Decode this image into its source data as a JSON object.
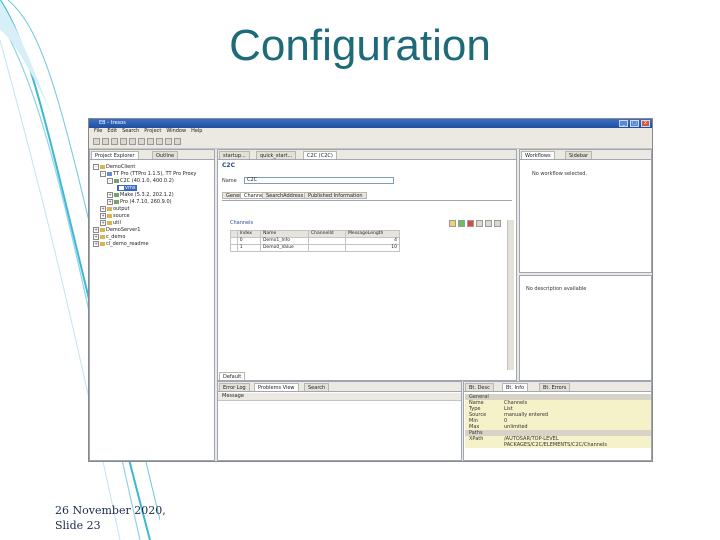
{
  "slide": {
    "title": "Configuration",
    "footer_line1": "26 November 2020,",
    "footer_line2": "Slide 23"
  },
  "window": {
    "title": "EB - tresos",
    "menu": [
      "File",
      "Edit",
      "Search",
      "Project",
      "Window",
      "Help"
    ]
  },
  "project_panel": {
    "tabs": [
      "Project Explorer",
      "Outline"
    ],
    "tree": [
      {
        "label": "DemoClient",
        "level": 0
      },
      {
        "label": "TT Pro (TTPro 1.1.5), TT Pro Proxy",
        "level": 1
      },
      {
        "label": "C2C (40.1.0, 400.0.2)",
        "level": 2
      },
      {
        "label": "vms",
        "level": 3
      },
      {
        "label": "Make (5.3.2, 202.1.2)",
        "level": 2
      },
      {
        "label": "Pro (4.7.10, 260.9.0)",
        "level": 2
      },
      {
        "label": "output",
        "level": 1
      },
      {
        "label": "source",
        "level": 1
      },
      {
        "label": "util",
        "level": 1
      },
      {
        "label": "DemoServer1",
        "level": 0
      },
      {
        "label": "c_demo",
        "level": 0
      },
      {
        "label": "cl_demo_readme",
        "level": 0
      }
    ]
  },
  "editor": {
    "tabs": [
      "startup...",
      "quick_start...",
      "C2C (C2C)"
    ],
    "header": "C2C",
    "name_label": "Name",
    "name_value": "C2C",
    "subtabs": [
      "General",
      "Channels",
      "SearchAddress",
      "Published Information"
    ],
    "section_title": "Channels",
    "table": {
      "headers": [
        "",
        "Index",
        "Name",
        "ChannelId",
        "MessageLength"
      ],
      "rows": [
        [
          "",
          "0",
          "Demo1_Info",
          "",
          "4"
        ],
        [
          "",
          "1",
          "Demo0_Value",
          "",
          "10"
        ]
      ]
    },
    "bottom_tab": "Default"
  },
  "outline_panel": {
    "tabs": [
      "Workflows",
      "Sidebar"
    ],
    "status": "No workflow selected.",
    "description": "No description available"
  },
  "log_panel": {
    "tabs": [
      "Error Log",
      "Problems View",
      "Search"
    ],
    "column": "Message"
  },
  "properties_panel": {
    "tabs": [
      "Bt. Desc",
      "Bt. Info",
      "Bt. Errors"
    ],
    "rows": [
      {
        "key": "General",
        "value": "",
        "group": true
      },
      {
        "key": "Name",
        "value": "Channels"
      },
      {
        "key": "Type",
        "value": "List"
      },
      {
        "key": "Source",
        "value": "manually entered"
      },
      {
        "key": "Min",
        "value": "0"
      },
      {
        "key": "Max",
        "value": "unlimited"
      },
      {
        "key": "Paths",
        "value": "",
        "group": true
      },
      {
        "key": "XPath",
        "value": "/AUTOSAR/TOP-LEVEL"
      },
      {
        "key": "",
        "value": "PACKAGES/C2C/ELEMENTS/C2C/Channels"
      }
    ]
  }
}
